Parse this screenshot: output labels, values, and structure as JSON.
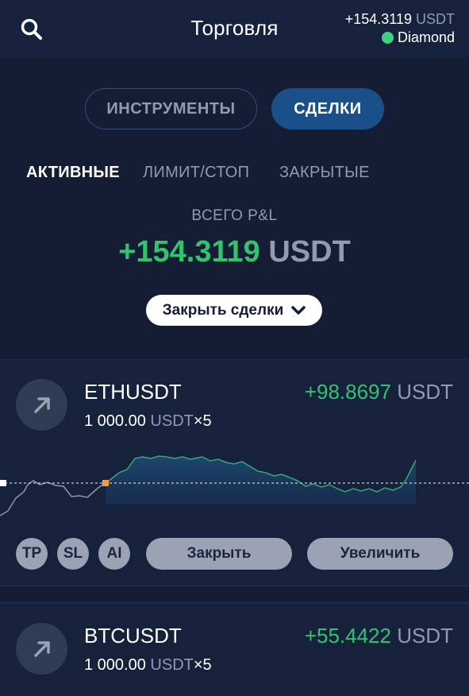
{
  "header": {
    "title": "Торговля",
    "balance_value": "+154.3119",
    "balance_unit": "USDT",
    "status_label": "Diamond",
    "status_color": "#3ed280",
    "search_icon": "search-icon"
  },
  "segments": {
    "instruments_label": "ИНСТРУМЕНТЫ",
    "deals_label": "СДЕЛКИ",
    "active": "deals"
  },
  "subtabs": {
    "active_label": "АКТИВНЫЕ",
    "limit_label": "ЛИМИТ/СТОП",
    "closed_label": "ЗАКРЫТЫЕ",
    "selected": "active"
  },
  "summary": {
    "label": "ВСЕГО P&L",
    "value": "+154.3119",
    "unit": "USDT",
    "close_deals_label": "Закрыть сделки"
  },
  "colors": {
    "positive": "#32c46d",
    "muted": "#8f9bb1",
    "background": "#141d33",
    "card": "#16223c"
  },
  "positions": [
    {
      "symbol": "ETHUSDT",
      "direction_icon": "arrow-up-right-icon",
      "amount": "1 000.00",
      "amount_unit": "USDT",
      "leverage": "×5",
      "pnl_value": "+98.8697",
      "pnl_unit": "USDT",
      "buttons": {
        "tp": "TP",
        "sl": "SL",
        "ai": "AI",
        "close": "Закрыть",
        "increase": "Увеличить"
      }
    },
    {
      "symbol": "BTCUSDT",
      "direction_icon": "arrow-up-right-icon",
      "amount": "1 000.00",
      "amount_unit": "USDT",
      "leverage": "×5",
      "pnl_value": "+55.4422",
      "pnl_unit": "USDT"
    }
  ]
}
